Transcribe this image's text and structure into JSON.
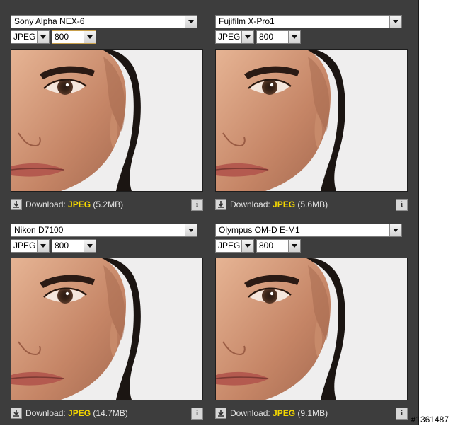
{
  "panels": [
    {
      "camera": "Sony Alpha NEX-6",
      "format": "JPEG",
      "iso": "800",
      "download_label": "Download:",
      "download_format": "JPEG",
      "download_size": "(5.2MB)",
      "info_label": "i"
    },
    {
      "camera": "Fujifilm X-Pro1",
      "format": "JPEG",
      "iso": "800",
      "download_label": "Download:",
      "download_format": "JPEG",
      "download_size": "(5.6MB)",
      "info_label": "i"
    },
    {
      "camera": "Nikon D7100",
      "format": "JPEG",
      "iso": "800",
      "download_label": "Download:",
      "download_format": "JPEG",
      "download_size": "(14.7MB)",
      "info_label": "i"
    },
    {
      "camera": "Olympus OM-D E-M1",
      "format": "JPEG",
      "iso": "800",
      "download_label": "Download:",
      "download_format": "JPEG",
      "download_size": "(9.1MB)",
      "info_label": "i"
    }
  ],
  "watermark": "#1361487",
  "colors": {
    "panel_bg": "#3d3d3d",
    "format_highlight": "#f5d800"
  },
  "icons": {
    "download": "download-arrow-icon",
    "info": "info-icon",
    "dropdown": "chevron-down-icon"
  }
}
